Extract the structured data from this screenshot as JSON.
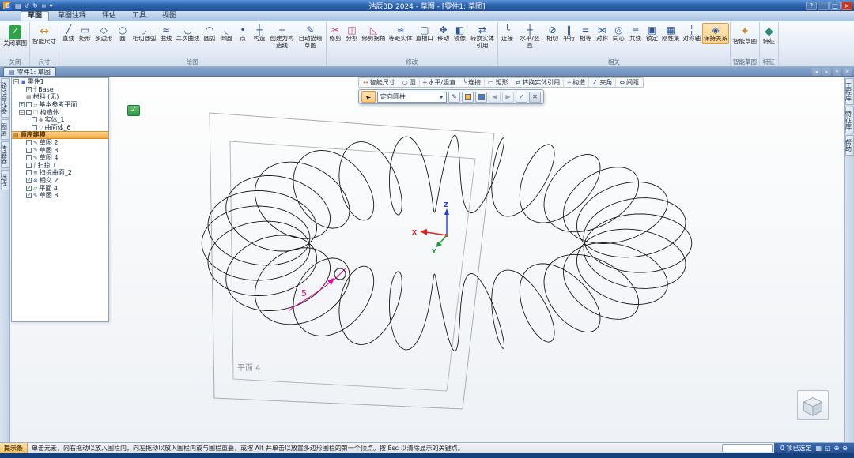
{
  "window": {
    "title": "浩辰3D 2024 - 草图 - [零件1: 草图]",
    "logo_letter": "G",
    "quick_access": [
      {
        "name": "save-icon",
        "glyph": "▤"
      },
      {
        "name": "undo-icon",
        "glyph": "↺"
      },
      {
        "name": "redo-icon",
        "glyph": "↻"
      },
      {
        "name": "print-icon",
        "glyph": "≡"
      },
      {
        "name": "customize-quick-access-icon",
        "glyph": "▾"
      }
    ],
    "controls": [
      "?",
      "−",
      "□",
      "×"
    ]
  },
  "ribbon_tabs": [
    {
      "label": "草图",
      "active": true
    },
    {
      "label": "草图注释",
      "active": false
    },
    {
      "label": "评估",
      "active": false
    },
    {
      "label": "工具",
      "active": false
    },
    {
      "label": "视图",
      "active": false
    }
  ],
  "ribbon_groups": [
    {
      "name": "关闭",
      "buttons": [
        {
          "name": "close-sketch-button",
          "label": "关闭草图",
          "glyph": "✓",
          "icon_style": "green-box",
          "large": true
        }
      ]
    },
    {
      "name": "尺寸",
      "buttons": [
        {
          "name": "smart-dimension-button",
          "label": "智能尺寸",
          "glyph": "↔",
          "color": "#c98a1b",
          "large": true
        }
      ]
    },
    {
      "name": "绘图",
      "buttons": [
        {
          "name": "line-button",
          "label": "直线",
          "glyph": "╱",
          "color": "#2b579a"
        },
        {
          "name": "rectangle-button",
          "label": "矩形",
          "glyph": "▭",
          "color": "#2b579a"
        },
        {
          "name": "polygon-button",
          "label": "多边形",
          "glyph": "◇",
          "color": "#2b579a"
        },
        {
          "name": "circle-button",
          "label": "圆",
          "glyph": "○",
          "color": "#2b579a"
        },
        {
          "name": "tangent-arc-button",
          "label": "相切圆弧",
          "glyph": "◞",
          "color": "#2b579a"
        },
        {
          "name": "curve-button",
          "label": "曲线",
          "glyph": "≈",
          "color": "#2b579a"
        },
        {
          "name": "conic-button",
          "label": "二次曲线",
          "glyph": "◡",
          "color": "#2b579a"
        },
        {
          "name": "arc-button",
          "label": "圆弧",
          "glyph": "◠",
          "color": "#2b579a"
        },
        {
          "name": "fillet-button",
          "label": "倒圆",
          "glyph": "◟",
          "color": "#2b579a"
        },
        {
          "name": "point-button",
          "label": "点",
          "glyph": "•",
          "color": "#2b579a"
        },
        {
          "name": "construction-button",
          "label": "构造",
          "glyph": "┼",
          "color": "#2b579a"
        },
        {
          "name": "convert-to-construction-button",
          "label": "创建为构造线",
          "glyph": "╌",
          "color": "#2b579a"
        },
        {
          "name": "auto-sketch-button",
          "label": "自动描绘草图",
          "glyph": "✎",
          "color": "#2b579a"
        }
      ]
    },
    {
      "name": "修改",
      "buttons": [
        {
          "name": "trim-button",
          "label": "修剪",
          "glyph": "✂",
          "color": "#c2437a"
        },
        {
          "name": "split-button",
          "label": "分割",
          "glyph": "◫",
          "color": "#c2437a"
        },
        {
          "name": "trim-corner-button",
          "label": "修剪拐角",
          "glyph": "◺",
          "color": "#c2437a"
        },
        {
          "name": "offset-entities-button",
          "label": "等距实体",
          "glyph": "≋",
          "color": "#2b579a"
        },
        {
          "name": "slot-button",
          "label": "直槽口",
          "glyph": "▢",
          "color": "#2b579a"
        },
        {
          "name": "move-button",
          "label": "移动",
          "glyph": "✥",
          "color": "#2b579a"
        },
        {
          "name": "mirror-button",
          "label": "镜像",
          "glyph": "◧",
          "color": "#2b579a"
        },
        {
          "name": "convert-entities-button",
          "label": "转换实体引用",
          "glyph": "⇄",
          "color": "#2b579a"
        }
      ]
    },
    {
      "name": "相关",
      "buttons": [
        {
          "name": "connect-button",
          "label": "连接",
          "glyph": "╰",
          "color": "#2b579a"
        },
        {
          "name": "horizontal-vertical-button",
          "label": "水平/竖直",
          "glyph": "┼",
          "color": "#2b579a"
        },
        {
          "name": "tangent-button",
          "label": "相切",
          "glyph": "⊘",
          "color": "#2b579a"
        },
        {
          "name": "parallel-button",
          "label": "平行",
          "glyph": "∥",
          "color": "#2b579a"
        },
        {
          "name": "equal-button",
          "label": "相等",
          "glyph": "=",
          "color": "#2b579a"
        },
        {
          "name": "symmetric-button",
          "label": "对称",
          "glyph": "⋈",
          "color": "#2b579a"
        },
        {
          "name": "concentric-button",
          "label": "同心",
          "glyph": "◎",
          "color": "#2b579a"
        },
        {
          "name": "collinear-button",
          "label": "共线",
          "glyph": "≡",
          "color": "#2b579a"
        },
        {
          "name": "lock-button",
          "label": "锁定",
          "glyph": "▣",
          "color": "#2b579a"
        },
        {
          "name": "rigid-set-button",
          "label": "刚性集",
          "glyph": "▦",
          "color": "#2b579a"
        },
        {
          "name": "symmetry-axis-button",
          "label": "对称轴",
          "glyph": "╎",
          "color": "#2b579a"
        },
        {
          "name": "maintain-relationships-button",
          "label": "保持关系",
          "glyph": "◈",
          "color": "#2b579a",
          "active": true
        }
      ]
    },
    {
      "name": "智能草图",
      "buttons": [
        {
          "name": "smart-sketch-button",
          "label": "智能草图",
          "glyph": "✦",
          "color": "#c98a1b",
          "large": true
        }
      ]
    },
    {
      "name": "特征",
      "buttons": [
        {
          "name": "feature-button",
          "label": "特征",
          "glyph": "◆",
          "color": "#2b8a78",
          "large": true
        }
      ]
    }
  ],
  "doc_tab": {
    "icon_glyph": "▤",
    "label": "零件1: 草图",
    "buttons": [
      {
        "name": "tab-prev-button",
        "glyph": "◂"
      },
      {
        "name": "tab-next-button",
        "glyph": "▸"
      },
      {
        "name": "tab-list-button",
        "glyph": "▾"
      },
      {
        "name": "tab-close-button",
        "glyph": "✕"
      }
    ]
  },
  "quickbar": {
    "items": [
      {
        "name": "smart-dimension-toggle",
        "label": "智能尺寸",
        "glyph": "↔",
        "color": "#c98a1b"
      },
      {
        "name": "circle-toggle",
        "label": "圆",
        "glyph": "○",
        "color": "#2b579a"
      },
      {
        "name": "horizontal-vertical-toggle",
        "label": "水平/竖直",
        "glyph": "┼",
        "color": "#2b579a"
      },
      {
        "name": "connect-toggle",
        "label": "连接",
        "glyph": "╰",
        "color": "#2b579a"
      },
      {
        "name": "rectangle-toggle",
        "label": "矩形",
        "glyph": "▭",
        "color": "#2b579a"
      },
      {
        "name": "convert-entities-toggle",
        "label": "转换实体引用",
        "glyph": "⇄",
        "color": "#2b579a"
      },
      {
        "name": "construction-toggle",
        "label": "构造",
        "glyph": "╌",
        "color": "#2b579a"
      },
      {
        "name": "angle-toggle",
        "label": "夹角",
        "glyph": "∠",
        "color": "#2b579a"
      },
      {
        "name": "spacing-toggle",
        "label": "间距",
        "glyph": "⇔",
        "color": "#2b579a"
      }
    ]
  },
  "command_bar": {
    "select_glyph": "➤",
    "dropdown_value": "定向圆柱",
    "buttons": [
      {
        "name": "style-picker-button",
        "glyph": "✎"
      },
      {
        "name": "fill-color-button",
        "swatch": "#f2b24c"
      },
      {
        "name": "line-color-button",
        "swatch": "#4a79c8"
      },
      {
        "name": "previous-button",
        "glyph": "◀",
        "disabled": true
      },
      {
        "name": "next-button",
        "glyph": "▶",
        "disabled": true
      },
      {
        "name": "accept-button",
        "glyph": "✓",
        "accent": true
      },
      {
        "name": "cancel-button",
        "glyph": "✕",
        "cancel": true
      }
    ]
  },
  "tree": {
    "rows": [
      {
        "indent": 0,
        "expander": "-",
        "icon": {
          "glyph": "▣",
          "color": "#3a6fd8"
        },
        "label": "零件1"
      },
      {
        "indent": 1,
        "check": true,
        "icon": {
          "glyph": "┼",
          "color": "#777777"
        },
        "label": "Base"
      },
      {
        "indent": 1,
        "icon": {
          "glyph": "▦",
          "color": "#777777"
        },
        "label": "材料 (无)"
      },
      {
        "indent": 1,
        "expander": "+",
        "check": false,
        "icon": {
          "glyph": "▱",
          "color": "#3f8f4f"
        },
        "label": "基本参考平面"
      },
      {
        "indent": 1,
        "expander": "-",
        "check": false,
        "icon": {
          "glyph": "▢",
          "color": "#777777"
        },
        "label": "构造体"
      },
      {
        "indent": 2,
        "check": false,
        "icon": {
          "glyph": "◆",
          "color": "#999999"
        },
        "label": "实体_1"
      },
      {
        "indent": 2,
        "check": false,
        "icon": {
          "glyph": "◇",
          "color": "#999999"
        },
        "label": "曲面体_6"
      },
      {
        "header": true,
        "icon": {
          "glyph": "▤",
          "color": "#7a4a00"
        },
        "label": "顺序建模"
      },
      {
        "indent": 1,
        "check": false,
        "icon": {
          "glyph": "✎",
          "color": "#2b579a"
        },
        "label": "草图 2"
      },
      {
        "indent": 1,
        "check": false,
        "icon": {
          "glyph": "✎",
          "color": "#2b579a"
        },
        "label": "草图 3"
      },
      {
        "indent": 1,
        "check": false,
        "icon": {
          "glyph": "✎",
          "color": "#2b579a"
        },
        "label": "草图 4"
      },
      {
        "indent": 1,
        "check": false,
        "icon": {
          "glyph": "∫",
          "color": "#2b579a"
        },
        "label": "扫掠 1"
      },
      {
        "indent": 1,
        "check": false,
        "icon": {
          "glyph": "≋",
          "color": "#2b579a"
        },
        "label": "扫掠曲面_2"
      },
      {
        "indent": 1,
        "check": true,
        "icon": {
          "glyph": "⊗",
          "color": "#2b579a"
        },
        "label": "相交 2"
      },
      {
        "indent": 1,
        "check": true,
        "icon": {
          "glyph": "▱",
          "color": "#3f8f4f"
        },
        "label": "平面 4"
      },
      {
        "indent": 1,
        "check": true,
        "icon": {
          "glyph": "✎",
          "color": "#2b579a"
        },
        "label": "草图 8"
      }
    ]
  },
  "left_tabs": [
    {
      "name": "tab-pathfinder",
      "label": "路径查找器"
    },
    {
      "name": "tab-layers",
      "label": "图层"
    },
    {
      "name": "tab-sensors",
      "label": "传感器"
    },
    {
      "name": "tab-select",
      "label": "选择"
    }
  ],
  "right_tabs": [
    {
      "name": "tab-library",
      "label": "工程库"
    },
    {
      "name": "tab-feature-library",
      "label": "特征库"
    },
    {
      "name": "tab-help",
      "label": "帮助"
    }
  ],
  "viewport": {
    "plane_label": "平面 4",
    "dimension_value": "5",
    "axis_labels": {
      "x": "X",
      "y": "Y",
      "z": "Z"
    },
    "accept_glyph": "✓"
  },
  "status_bar": {
    "chip": "提示条",
    "hint": "单击元素，向右拖动以放入围栏内，向左拖动以放入围栏内或与围栏重叠，或按 Alt 并单击以放置多边形围栏的第一个顶点。按 Esc 以清除显示的关键点。",
    "selection": "0 项已选定",
    "icons": [
      {
        "name": "display-options-icon",
        "glyph": "▦"
      },
      {
        "name": "fit-view-icon",
        "glyph": "◱"
      },
      {
        "name": "zoom-in-icon",
        "glyph": "⊕"
      },
      {
        "name": "zoom-out-icon",
        "glyph": "⊖"
      }
    ]
  }
}
